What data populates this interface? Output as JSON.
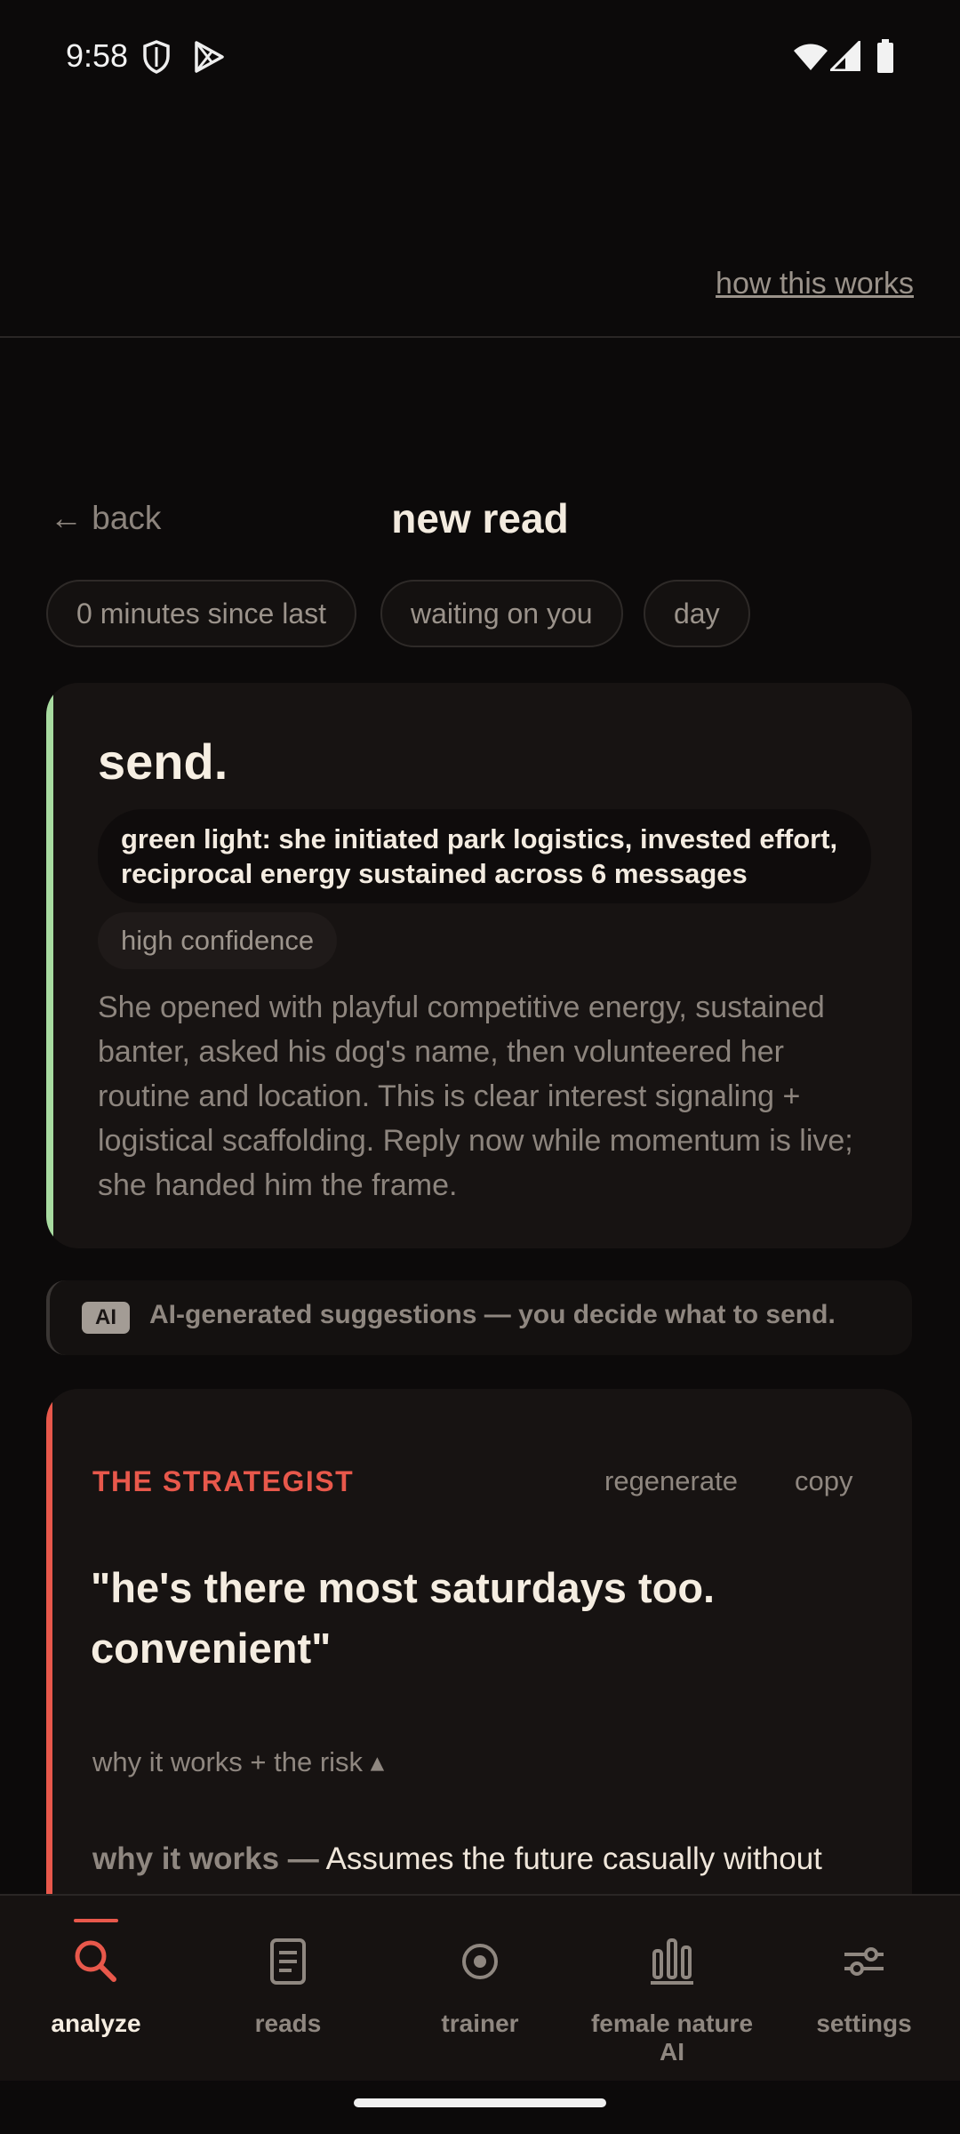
{
  "status_bar": {
    "time": "9:58"
  },
  "header": {
    "how_link": "how this works"
  },
  "page": {
    "back_label": "← back",
    "title": "new read"
  },
  "chips": [
    "0 minutes since last",
    "waiting on you",
    "day"
  ],
  "verdict": {
    "headline": "send.",
    "reason": "green light: she initiated park logistics, invested effort, reciprocal energy sustained across 6 messages",
    "confidence": "high confidence",
    "description": "She opened with playful competitive energy, sustained banter, asked his dog's name, then volunteered her routine and location. This is clear interest signaling + logistical scaffolding. Reply now while momentum is live; she handed him the frame.",
    "accent_color": "#a8dba0"
  },
  "ai_notice": {
    "tag": "AI",
    "text": "AI-generated suggestions — you decide what to send."
  },
  "strategist": {
    "label": "THE STRATEGIST",
    "regenerate": "regenerate",
    "copy": "copy",
    "quote": "\"he's there most saturdays too. convenient\"",
    "why_toggle": "why it works + the risk ▴",
    "why_label": "why it works —",
    "why_text": " Assumes the future casually without",
    "accent_color": "#e8584b"
  },
  "nav": {
    "items": [
      {
        "label": "analyze",
        "icon": "search-icon",
        "active": true
      },
      {
        "label": "reads",
        "icon": "document-icon",
        "active": false
      },
      {
        "label": "trainer",
        "icon": "target-icon",
        "active": false
      },
      {
        "label": "female nature AI",
        "icon": "bar-chart-icon",
        "active": false
      },
      {
        "label": "settings",
        "icon": "sliders-icon",
        "active": false
      }
    ]
  }
}
